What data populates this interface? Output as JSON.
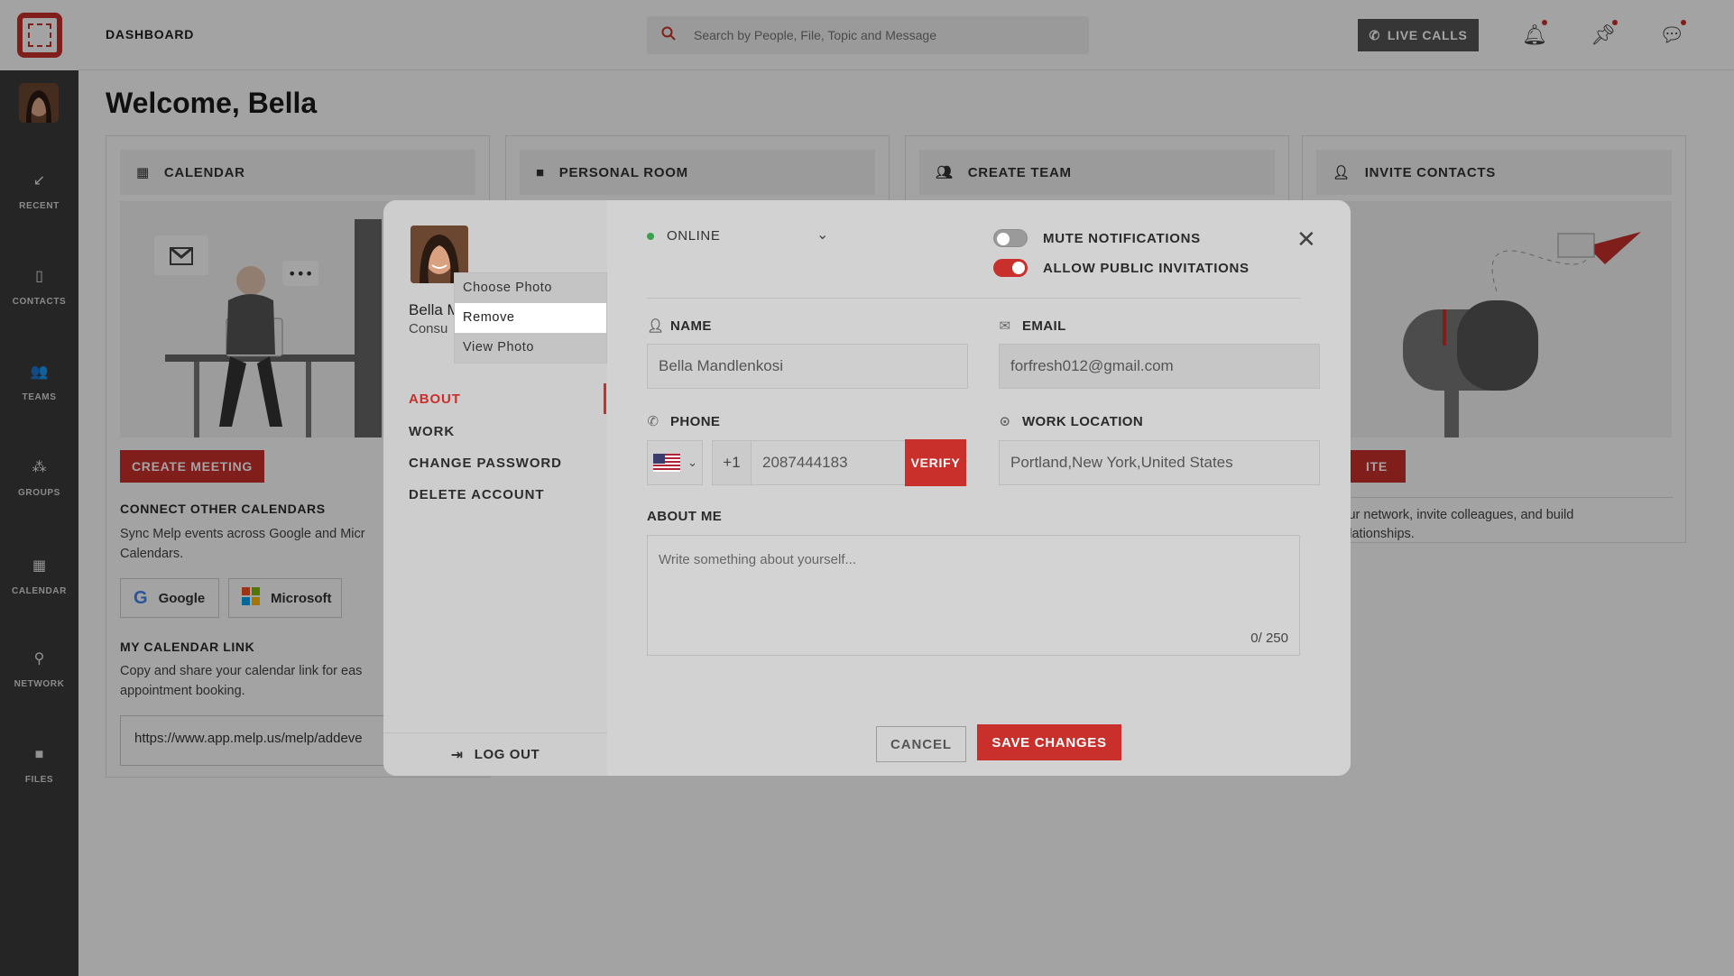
{
  "app": {
    "header_title": "DASHBOARD",
    "search_placeholder": "Search by People, File, Topic and Message",
    "live_calls": "LIVE CALLS"
  },
  "sidebar": {
    "items": [
      {
        "label": "RECENT",
        "icon": "arrow-down-left-icon"
      },
      {
        "label": "CONTACTS",
        "icon": "contacts-icon"
      },
      {
        "label": "TEAMS",
        "icon": "teams-icon"
      },
      {
        "label": "GROUPS",
        "icon": "groups-icon"
      },
      {
        "label": "CALENDAR",
        "icon": "calendar-icon"
      },
      {
        "label": "NETWORK",
        "icon": "network-icon"
      },
      {
        "label": "FILES",
        "icon": "folder-icon"
      }
    ]
  },
  "main": {
    "welcome": "Welcome, Bella",
    "cards": [
      {
        "title": "CALENDAR"
      },
      {
        "title": "PERSONAL ROOM"
      },
      {
        "title": "CREATE TEAM"
      },
      {
        "title": "INVITE CONTACTS"
      }
    ],
    "calendar": {
      "create_meeting": "CREATE MEETING",
      "connect_title": "CONNECT OTHER CALENDARS",
      "connect_text": "Sync Melp events across Google and Micr",
      "connect_text2": "Calendars.",
      "google": "Google",
      "microsoft": "Microsoft",
      "link_title": "MY CALENDAR LINK",
      "link_text": "Copy and share your calendar link for eas",
      "link_text2": "appointment booking.",
      "link_url": "https://www.app.melp.us/melp/addeve"
    },
    "invite": {
      "button_partial": "ITE",
      "text": "nd your network, invite colleagues, and build",
      "text2": "ble relationships."
    }
  },
  "modal": {
    "profile_name": "Bella M",
    "profile_role": "Consu",
    "photo_menu": [
      "Choose Photo",
      "Remove",
      "View Photo"
    ],
    "nav": [
      "ABOUT",
      "WORK",
      "CHANGE PASSWORD",
      "DELETE ACCOUNT"
    ],
    "logout": "LOG OUT",
    "status": "ONLINE",
    "mute_notifications": "MUTE NOTIFICATIONS",
    "allow_public_invitations": "ALLOW PUBLIC INVITATIONS",
    "mute_on": false,
    "allow_on": true,
    "name_label": "NAME",
    "name_value": "Bella Mandlenkosi",
    "email_label": "EMAIL",
    "email_value": "forfresh012@gmail.com",
    "phone_label": "PHONE",
    "dial_code": "+1",
    "phone_value": "2087444183",
    "verify": "VERIFY",
    "location_label": "WORK LOCATION",
    "location_value": "Portland,New York,United States",
    "about_label": "ABOUT ME",
    "about_placeholder": "Write something about yourself...",
    "about_count": "0/ 250",
    "cancel": "CANCEL",
    "save": "SAVE CHANGES"
  },
  "colors": {
    "accent": "#c9302c",
    "online": "#3aa24a"
  }
}
